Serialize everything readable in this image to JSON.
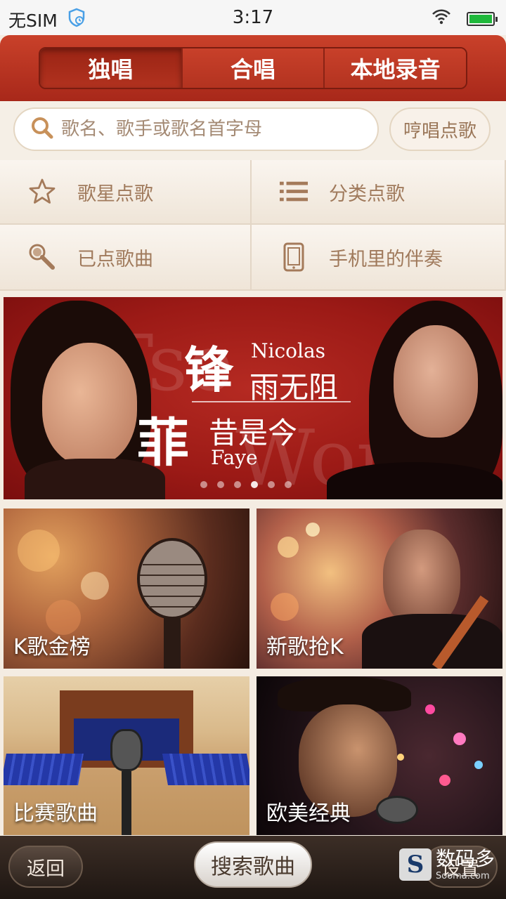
{
  "status_bar": {
    "carrier": "无SIM",
    "time": "3:17"
  },
  "tabs": [
    {
      "label": "独唱",
      "active": true
    },
    {
      "label": "合唱",
      "active": false
    },
    {
      "label": "本地录音",
      "active": false
    }
  ],
  "search": {
    "placeholder": "歌名、歌手或歌名首字母",
    "hum_button": "哼唱点歌"
  },
  "menu": [
    {
      "label": "歌星点歌",
      "icon": "star-icon"
    },
    {
      "label": "分类点歌",
      "icon": "list-icon"
    },
    {
      "label": "已点歌曲",
      "icon": "microphone-icon"
    },
    {
      "label": "手机里的伴奏",
      "icon": "phone-icon"
    }
  ],
  "banner": {
    "char_1": "锋",
    "name_1": "Nicolas",
    "line_1": "雨无阻",
    "char_2": "菲",
    "line_2": "昔是今",
    "name_2": "Faye",
    "watermark_1": "Tse",
    "watermark_2": "Wong"
  },
  "categories": [
    {
      "label": "K歌金榜"
    },
    {
      "label": "新歌抢K"
    },
    {
      "label": "比赛歌曲"
    },
    {
      "label": "欧美经典"
    }
  ],
  "bottom_bar": {
    "back_label": "返回",
    "search_songs_label": "搜索歌曲",
    "right_label": "设置",
    "watermark_cn": "数码多",
    "watermark_en": "Sooma.com",
    "watermark_letter": "S"
  },
  "colors": {
    "header_red": "#b53320",
    "banner_red": "#9c1a16",
    "menu_text": "#a07a5c",
    "battery_green": "#1fb83b"
  }
}
